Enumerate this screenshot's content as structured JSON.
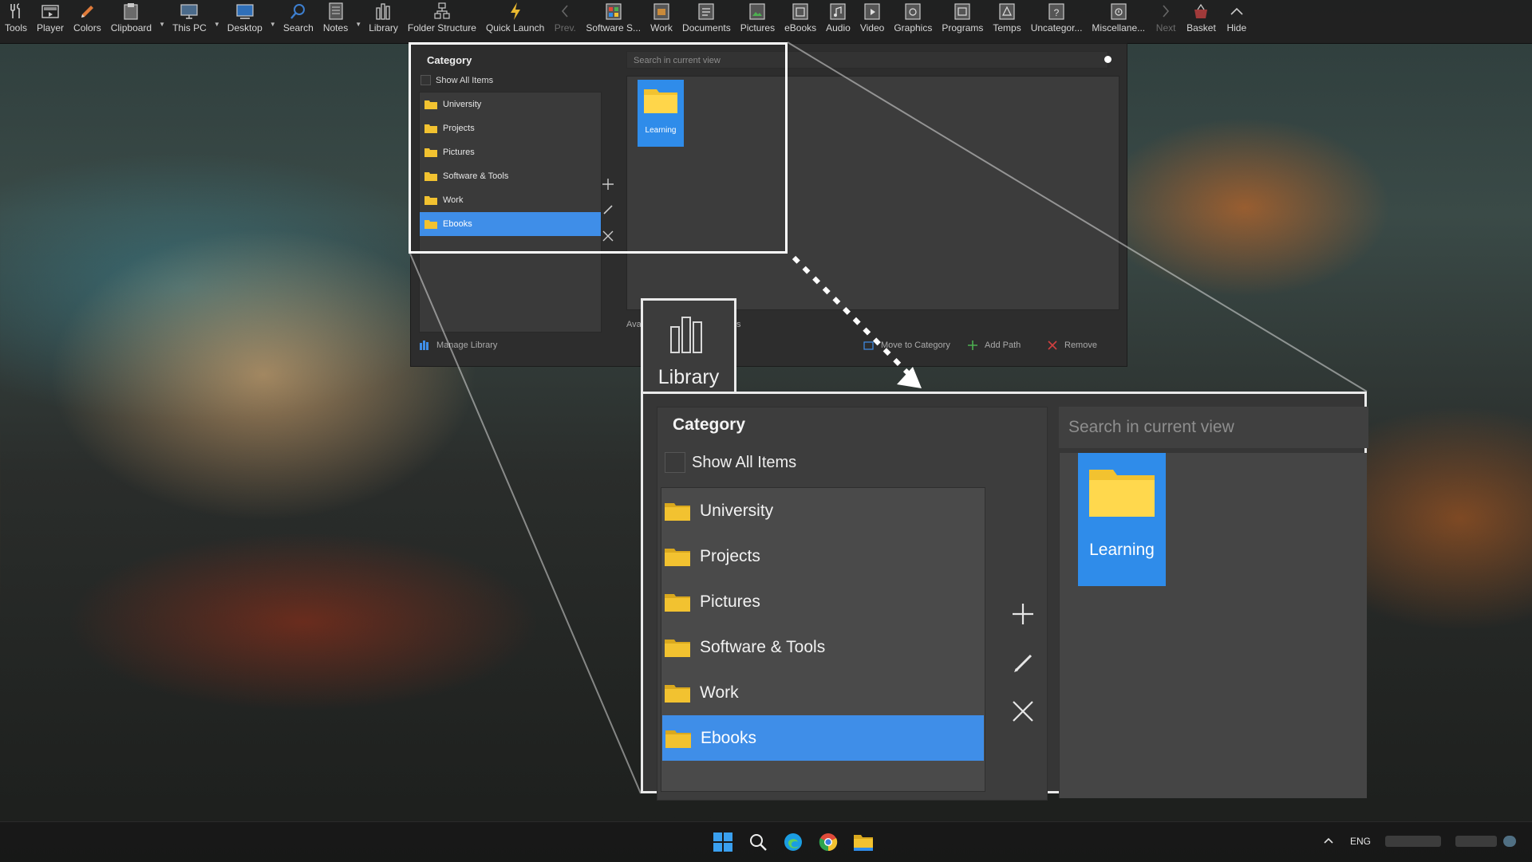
{
  "toolbar": {
    "items": [
      {
        "label": "Tools",
        "icon": "tools-icon"
      },
      {
        "label": "Player",
        "icon": "player-icon"
      },
      {
        "label": "Colors",
        "icon": "colors-icon"
      },
      {
        "label": "Clipboard",
        "icon": "clipboard-icon"
      },
      {
        "label": "This PC",
        "icon": "this-pc-icon"
      },
      {
        "label": "Desktop",
        "icon": "desktop-icon"
      },
      {
        "label": "Search",
        "icon": "search-icon"
      },
      {
        "label": "Notes",
        "icon": "notes-icon"
      },
      {
        "label": "Library",
        "icon": "library-icon"
      },
      {
        "label": "Folder Structure",
        "icon": "folder-structure-icon"
      },
      {
        "label": "Quick Launch",
        "icon": "lightning-icon"
      },
      {
        "label": "Prev.",
        "icon": "chevron-left-icon"
      },
      {
        "label": "Software S...",
        "icon": "software-icon"
      },
      {
        "label": "Work",
        "icon": "work-icon"
      },
      {
        "label": "Documents",
        "icon": "documents-icon"
      },
      {
        "label": "Pictures",
        "icon": "pictures-icon"
      },
      {
        "label": "eBooks",
        "icon": "ebooks-icon"
      },
      {
        "label": "Audio",
        "icon": "audio-icon"
      },
      {
        "label": "Video",
        "icon": "video-icon"
      },
      {
        "label": "Graphics",
        "icon": "graphics-icon"
      },
      {
        "label": "Programs",
        "icon": "programs-icon"
      },
      {
        "label": "Temps",
        "icon": "temps-icon"
      },
      {
        "label": "Uncategor...",
        "icon": "question-icon"
      },
      {
        "label": "Miscellane...",
        "icon": "misc-icon"
      },
      {
        "label": "Next",
        "icon": "chevron-right-icon"
      },
      {
        "label": "Basket",
        "icon": "basket-icon"
      },
      {
        "label": "Hide",
        "icon": "chevron-up-icon"
      }
    ]
  },
  "library": {
    "category_title": "Category",
    "show_all_label": "Show All Items",
    "categories": [
      "University",
      "Projects",
      "Pictures",
      "Software & Tools",
      "Work",
      "Ebooks"
    ],
    "selected_category": "Ebooks",
    "search_placeholder": "Search in current view",
    "items": [
      {
        "label": "Learning"
      }
    ],
    "footer": {
      "manage": "Manage Library",
      "available_partial": "Ava",
      "partial_suffix": "s",
      "move": "Move to Category",
      "add_path": "Add Path",
      "remove": "Remove"
    }
  },
  "zoom": {
    "tab_label": "Library"
  },
  "taskbar": {
    "apps": [
      "windows-start-icon",
      "search-icon",
      "edge-icon",
      "chrome-icon",
      "file-explorer-icon"
    ],
    "language": "ENG"
  },
  "colors": {
    "selection": "#3f8ee8",
    "folder": "#f2c230",
    "toolbar_bg": "#202020",
    "panel_bg": "#2d2d2d"
  }
}
